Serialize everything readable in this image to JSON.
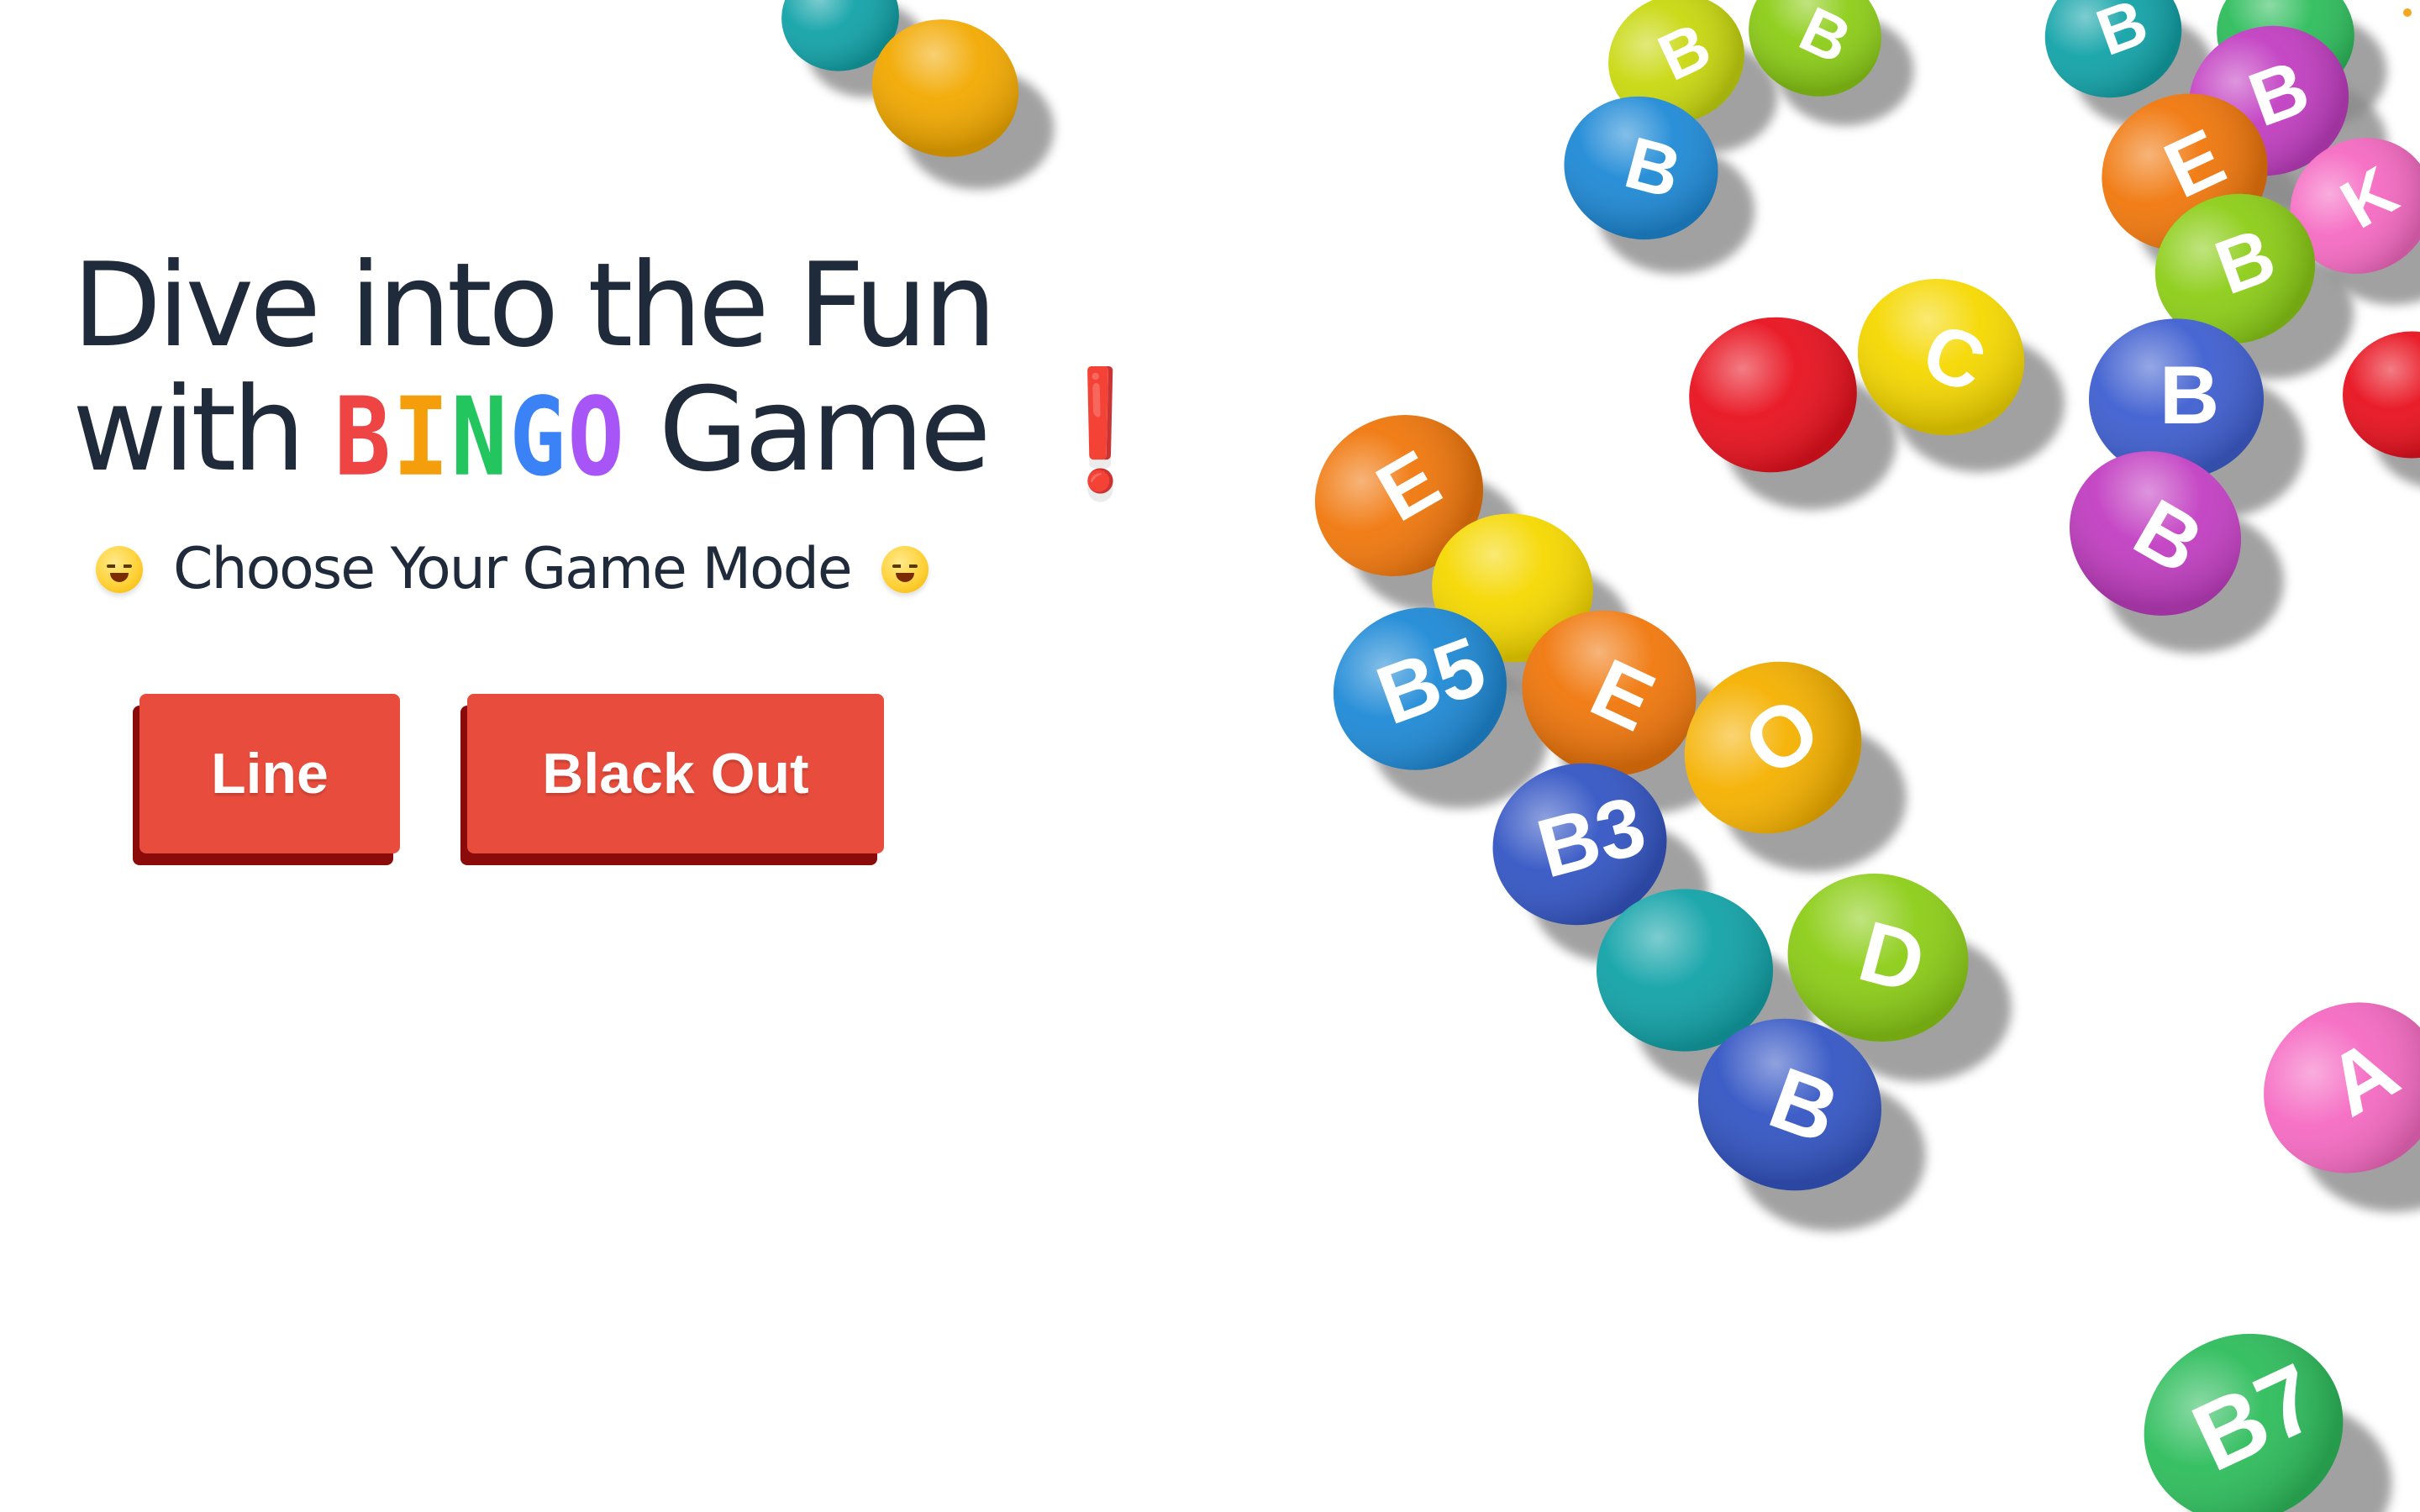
{
  "hero": {
    "title_line1": "Dive into the Fun",
    "title_line2_prefix": "with",
    "title_bingo_letters": [
      "B",
      "I",
      "N",
      "G",
      "O"
    ],
    "title_line2_suffix": "Game",
    "title_exclamation": "❗",
    "subtitle": "Choose Your Game Mode"
  },
  "colors": {
    "text": "#1f2a3a",
    "button": "#e74c3c",
    "button_shadow": "#8b0a0a",
    "bingo_letters": [
      "#ef4444",
      "#f97316",
      "#22c55e",
      "#3b82f6",
      "#a855f7"
    ]
  },
  "buttons": {
    "line_label": "Line",
    "blackout_label": "Black Out"
  },
  "icons": {
    "subtitle_left": "grinning-face-icon",
    "subtitle_right": "grinning-face-icon",
    "exclamation": "exclamation-icon"
  },
  "balls": [
    {
      "label": "",
      "color": "#12a3a8"
    },
    {
      "label": "",
      "color": "#f2a900"
    },
    {
      "label": "B",
      "color": "#c9d80f"
    },
    {
      "label": "B",
      "color": "#8ccd17"
    },
    {
      "label": "B",
      "color": "#1f8ad6"
    },
    {
      "label": "",
      "color": "#e8121f"
    },
    {
      "label": "C",
      "color": "#f5d800"
    },
    {
      "label": "E",
      "color": "#f0770c"
    },
    {
      "label": "",
      "color": "#f5d800"
    },
    {
      "label": "B5",
      "color": "#1f8ad6"
    },
    {
      "label": "E",
      "color": "#f0770c"
    },
    {
      "label": "O",
      "color": "#f5b100"
    },
    {
      "label": "B3",
      "color": "#3456c4"
    },
    {
      "label": "",
      "color": "#12a3a8"
    },
    {
      "label": "D",
      "color": "#8ccd17"
    },
    {
      "label": "B",
      "color": "#3456c4"
    },
    {
      "label": "B",
      "color": "#12a3a8"
    },
    {
      "label": "",
      "color": "#2ebd5c"
    },
    {
      "label": "B",
      "color": "#c23ec2"
    },
    {
      "label": "E",
      "color": "#f0770c"
    },
    {
      "label": "K",
      "color": "#f56ac2"
    },
    {
      "label": "B",
      "color": "#8ccd17"
    },
    {
      "label": "B",
      "color": "#3f5fd0"
    },
    {
      "label": "B",
      "color": "#c23ec2"
    },
    {
      "label": "",
      "color": "#e8121f"
    },
    {
      "label": "A",
      "color": "#f56ac2"
    },
    {
      "label": "B7",
      "color": "#2ebd5c"
    }
  ]
}
